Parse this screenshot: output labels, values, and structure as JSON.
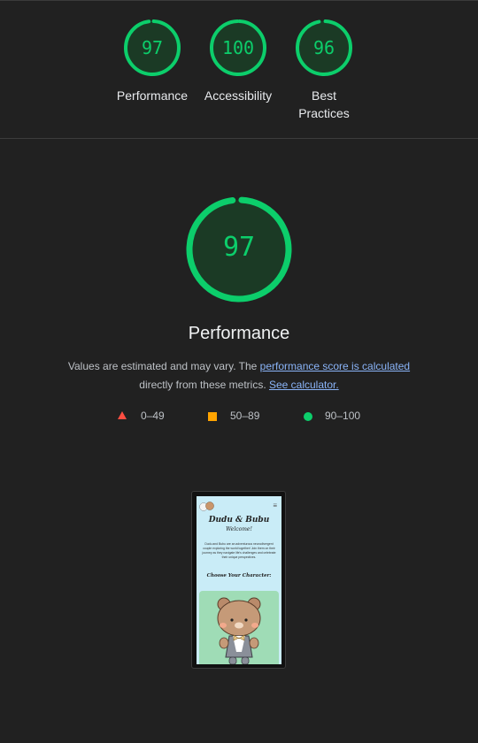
{
  "top_scores": [
    {
      "score": "97",
      "label": "Performance",
      "fraction": 0.97
    },
    {
      "score": "100",
      "label": "Accessibility",
      "fraction": 1.0
    },
    {
      "score": "96",
      "label": "Best Practices",
      "fraction": 0.96
    }
  ],
  "main": {
    "score": "97",
    "fraction": 0.97,
    "title": "Performance",
    "desc_prefix": "Values are estimated and may vary. The ",
    "desc_link": "performance score is calculated",
    "desc_middle": " directly from these metrics. ",
    "calc_link": "See calculator."
  },
  "legend": [
    {
      "shape": "triangle-icon",
      "label": "0–49",
      "color": "#ff4e42"
    },
    {
      "shape": "square-icon",
      "label": "50–89",
      "color": "#ffa400"
    },
    {
      "shape": "circle-icon",
      "label": "90–100",
      "color": "#0cce6b"
    }
  ],
  "screenshot": {
    "title": "Dudu & Bubu",
    "subtitle": "Welcome!",
    "blurb": "Dudu and Bubu are an adventurous neurodivergent couple exploring the world together! Join them on their journey as they navigate life's challenges and celebrate their unique perspectives.",
    "section_heading": "Choose Your Character:",
    "menu_icon": "hamburger-icon"
  },
  "colors": {
    "pass": "#0cce6b",
    "average": "#ffa400",
    "fail": "#ff4e42",
    "background": "#212121",
    "link": "#8ab4f8"
  }
}
